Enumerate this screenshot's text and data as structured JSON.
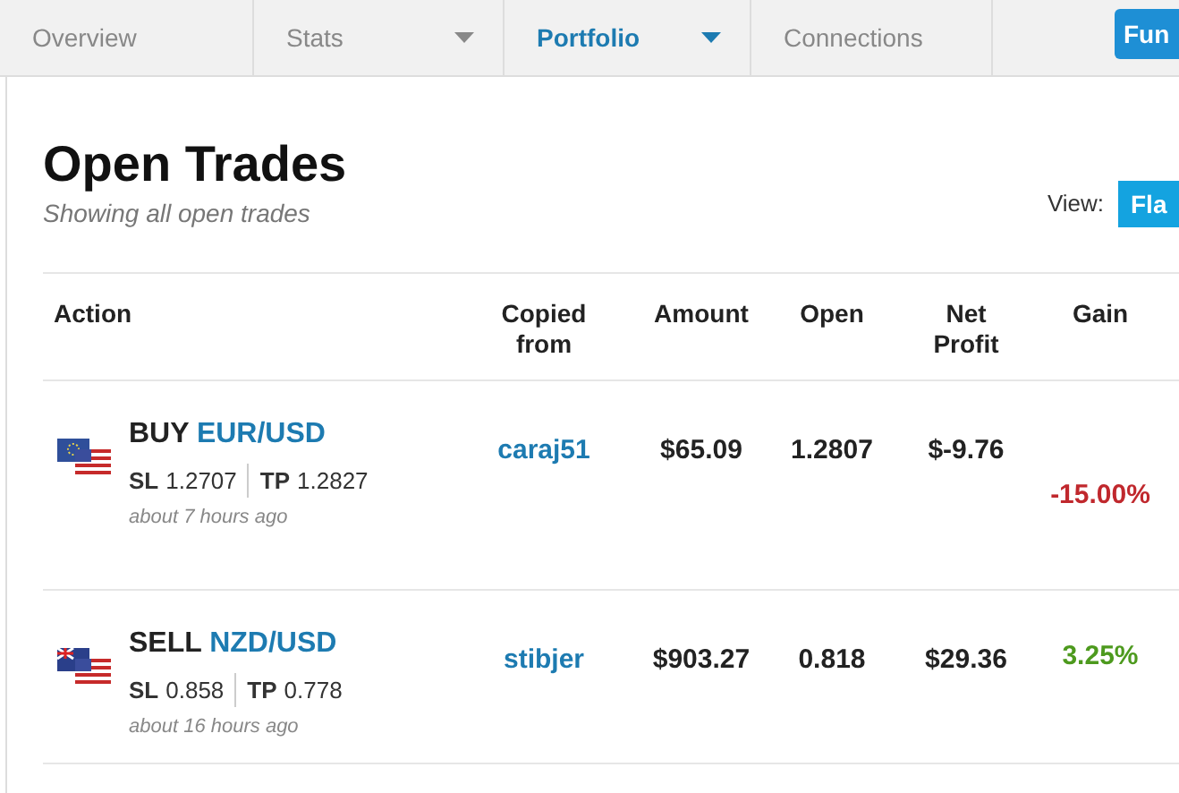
{
  "tabs": [
    {
      "label": "Overview",
      "selected": false,
      "dropdown": false
    },
    {
      "label": "Stats",
      "selected": false,
      "dropdown": true
    },
    {
      "label": "Portfolio",
      "selected": true,
      "dropdown": true
    },
    {
      "label": "Connections",
      "selected": false,
      "dropdown": false
    }
  ],
  "nav_button": "Fun",
  "title": "Open Trades",
  "subtitle": "Showing all open trades",
  "view": {
    "label": "View:",
    "button": "Fla"
  },
  "columns": [
    "Action",
    "Copied from",
    "Amount",
    "Open",
    "Net Profit",
    "Gain"
  ],
  "trades": [
    {
      "side": "BUY",
      "pair": "EUR/USD",
      "kind": "eu",
      "sl_label": "SL",
      "sl": "1.2707",
      "tp_label": "TP",
      "tp": "1.2827",
      "time": "about 7 hours ago",
      "copied_from": "caraj51",
      "amount": "$65.09",
      "open": "1.2807",
      "net_profit": "$-9.76",
      "gain": "-15.00%",
      "loss": true
    },
    {
      "side": "SELL",
      "pair": "NZD/USD",
      "kind": "nz",
      "sl_label": "SL",
      "sl": "0.858",
      "tp_label": "TP",
      "tp": "0.778",
      "time": "about 16 hours ago",
      "copied_from": "stibjer",
      "amount": "$903.27",
      "open": "0.818",
      "net_profit": "$29.36",
      "gain": "3.25%",
      "loss": false
    }
  ]
}
